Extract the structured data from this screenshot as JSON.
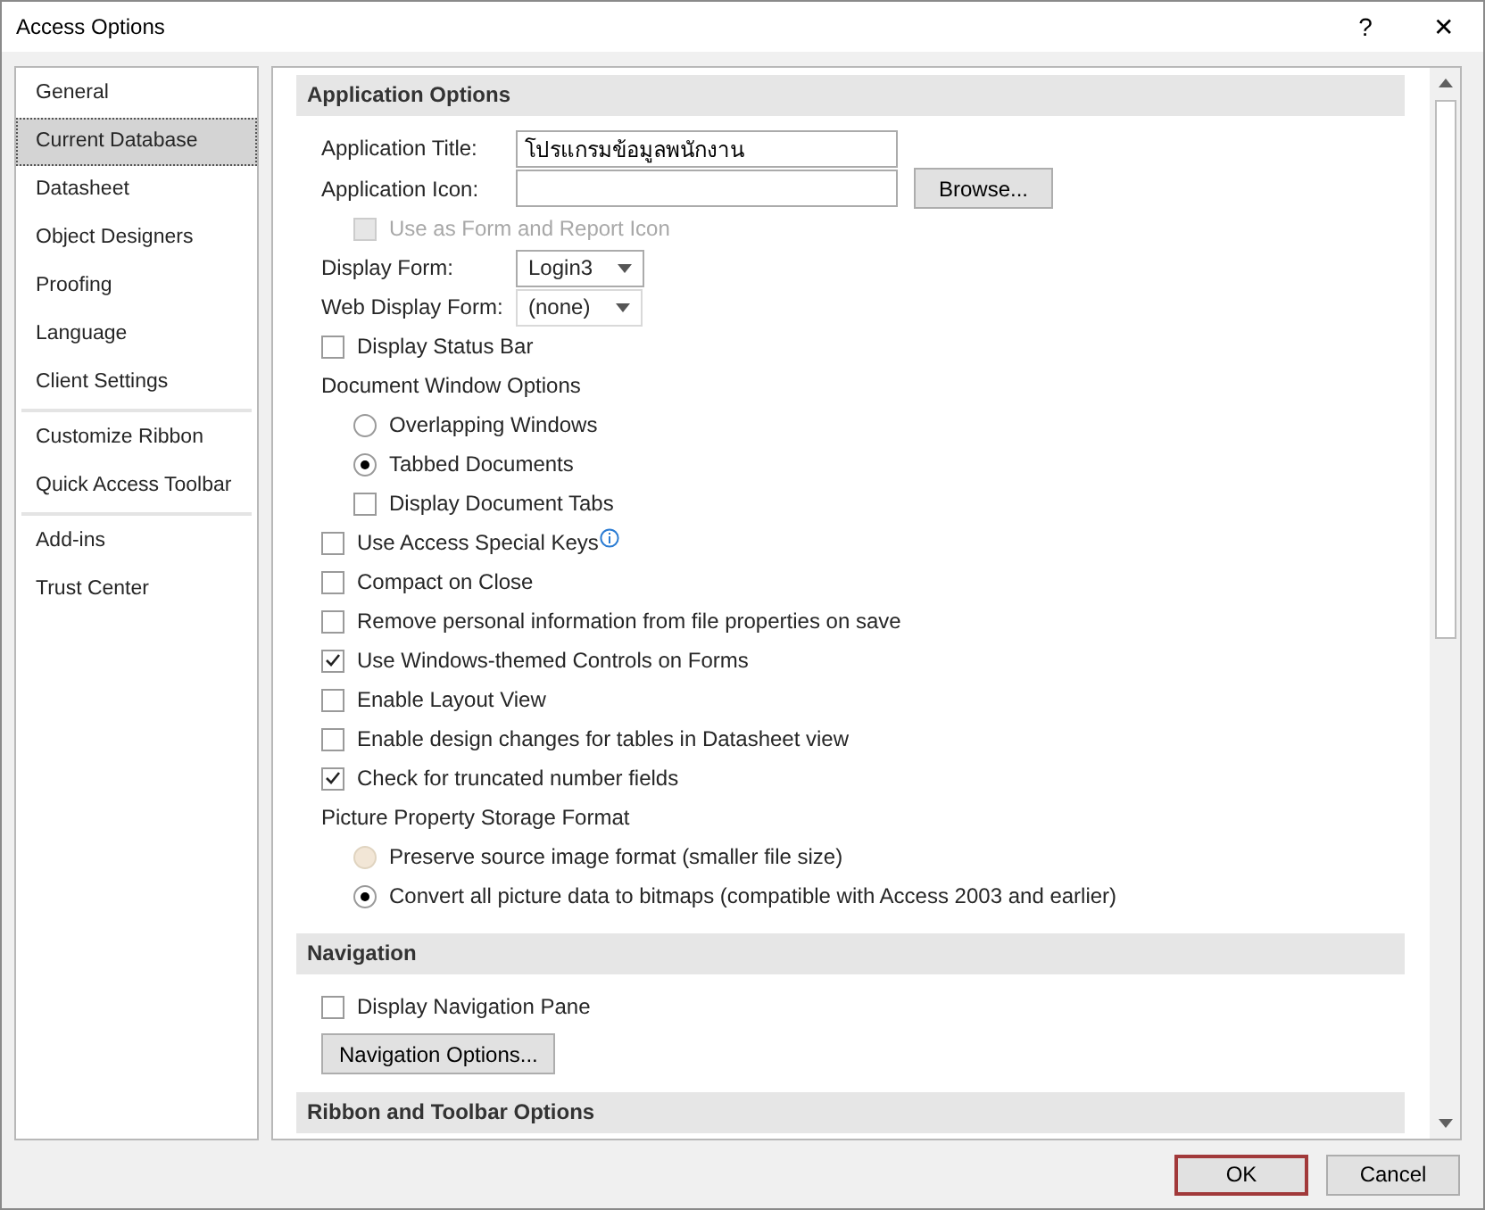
{
  "window": {
    "title": "Access Options",
    "help": "?",
    "close": "✕"
  },
  "sidebar": {
    "groups": [
      [
        {
          "label": "General",
          "selected": false
        },
        {
          "label": "Current Database",
          "selected": true
        },
        {
          "label": "Datasheet",
          "selected": false
        },
        {
          "label": "Object Designers",
          "selected": false
        },
        {
          "label": "Proofing",
          "selected": false
        },
        {
          "label": "Language",
          "selected": false
        },
        {
          "label": "Client Settings",
          "selected": false
        }
      ],
      [
        {
          "label": "Customize Ribbon",
          "selected": false
        },
        {
          "label": "Quick Access Toolbar",
          "selected": false
        }
      ],
      [
        {
          "label": "Add-ins",
          "selected": false
        },
        {
          "label": "Trust Center",
          "selected": false
        }
      ]
    ]
  },
  "sections": [
    {
      "title": "Application Options",
      "items": [
        {
          "kind": "text",
          "label": "Application Title:",
          "value": "โปรแกรมข้อมูลพนักงาน"
        },
        {
          "kind": "file",
          "label": "Application Icon:",
          "button": "Browse...",
          "children": [
            {
              "kind": "checkbox",
              "label": "Use as Form and Report Icon",
              "checked": false,
              "disabled": true
            }
          ]
        },
        {
          "kind": "dropdown",
          "label": "Display Form:",
          "value": "Login3",
          "disabled": false
        },
        {
          "kind": "dropdown",
          "label": "Web Display Form:",
          "value": "(none)",
          "disabled": true
        },
        {
          "kind": "checkbox",
          "label": "Display Status Bar",
          "checked": false,
          "disabled": false
        },
        {
          "kind": "group",
          "label": "Document Window Options",
          "children": [
            {
              "kind": "radio",
              "label": "Overlapping Windows",
              "selected": false,
              "disabled": false
            },
            {
              "kind": "radio",
              "label": "Tabbed Documents",
              "selected": true,
              "disabled": false
            },
            {
              "kind": "checkbox",
              "label": "Display Document Tabs",
              "checked": false,
              "disabled": false
            }
          ]
        },
        {
          "kind": "checkbox",
          "label": "Use Access Special Keys",
          "checked": false,
          "disabled": false,
          "info": true
        },
        {
          "kind": "checkbox",
          "label": "Compact on Close",
          "checked": false,
          "disabled": false
        },
        {
          "kind": "checkbox",
          "label": "Remove personal information from file properties on save",
          "checked": false,
          "disabled": false
        },
        {
          "kind": "checkbox",
          "label": "Use Windows-themed Controls on Forms",
          "checked": true,
          "disabled": false
        },
        {
          "kind": "checkbox",
          "label": "Enable Layout View",
          "checked": false,
          "disabled": false
        },
        {
          "kind": "checkbox",
          "label": "Enable design changes for tables in Datasheet view",
          "checked": false,
          "disabled": false
        },
        {
          "kind": "checkbox",
          "label": "Check for truncated number fields",
          "checked": true,
          "disabled": false
        },
        {
          "kind": "group",
          "label": "Picture Property Storage Format",
          "children": [
            {
              "kind": "radio",
              "label": "Preserve source image format (smaller file size)",
              "selected": false,
              "disabled": true
            },
            {
              "kind": "radio",
              "label": "Convert all picture data to bitmaps (compatible with Access 2003 and earlier)",
              "selected": true,
              "disabled": false
            }
          ]
        }
      ]
    },
    {
      "title": "Navigation",
      "items": [
        {
          "kind": "checkbox",
          "label": "Display Navigation Pane",
          "checked": false,
          "disabled": false
        },
        {
          "kind": "button",
          "label": "Navigation Options..."
        }
      ]
    },
    {
      "title": "Ribbon and Toolbar Options"
    }
  ],
  "buttons": [
    {
      "label": "OK",
      "default": true
    },
    {
      "label": "Cancel",
      "default": false
    }
  ]
}
